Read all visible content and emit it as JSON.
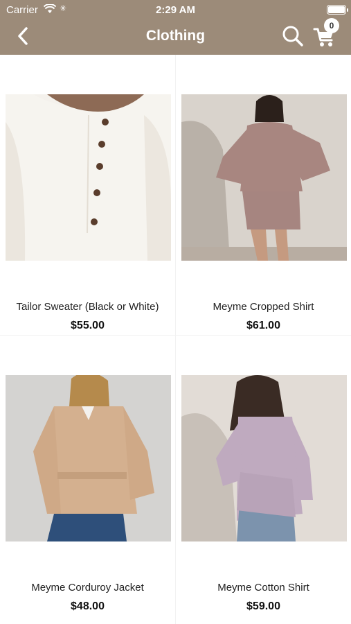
{
  "status_bar": {
    "carrier": "Carrier",
    "time": "2:29 AM"
  },
  "nav": {
    "title": "Clothing",
    "cart_count": "0"
  },
  "products": [
    {
      "name": "Tailor Sweater (Black or White)",
      "price": "$55.00"
    },
    {
      "name": "Meyme Cropped Shirt",
      "price": "$61.00"
    },
    {
      "name": "Meyme Corduroy Jacket",
      "price": "$48.00"
    },
    {
      "name": "Meyme Cotton Shirt",
      "price": "$59.00"
    }
  ],
  "colors": {
    "header": "#9c8b79"
  },
  "icons": {
    "back": "chevron-left-icon",
    "search": "search-icon",
    "cart": "cart-icon"
  }
}
